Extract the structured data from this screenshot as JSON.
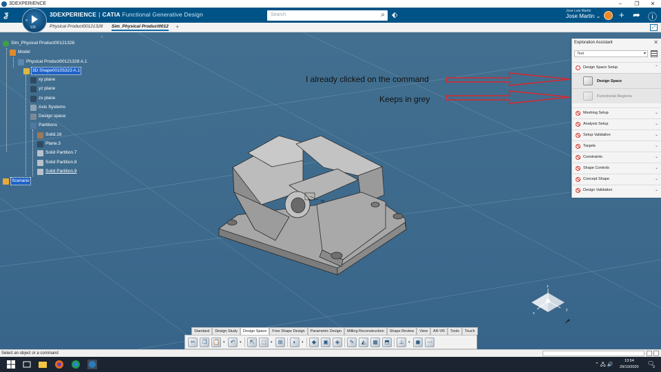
{
  "window": {
    "title": "3DEXPERIENCE",
    "controls": [
      "–",
      "❐",
      "✕"
    ]
  },
  "header": {
    "brand_bold": "3DEXPERIENCE",
    "brand_sep": "|",
    "brand_app": "CATIA",
    "brand_module": "Functional Generative Design",
    "compass_version": "V,R",
    "search_placeholder": "Search",
    "user_small": "Jose Luis Martin",
    "user_name": "Jose Martin",
    "user_caret": "⌄"
  },
  "tabs": [
    {
      "label": "Physical Product00121328",
      "active": false
    },
    {
      "label": "Sim_Physical Product0012",
      "active": true
    }
  ],
  "tab_add": "+",
  "tree": {
    "collapse_marker": "‹",
    "nodes": [
      {
        "label": "Sim_Physical Product00121328"
      },
      {
        "label": "Model"
      },
      {
        "label": "Physical Product00121328 A.1"
      },
      {
        "label": "3D Shape00105323 A.1"
      },
      {
        "label": "xy plane"
      },
      {
        "label": "yz plane"
      },
      {
        "label": "zx plane"
      },
      {
        "label": "Axis Systems"
      },
      {
        "label": "Design space"
      },
      {
        "label": "Partitions"
      },
      {
        "label": "Solid.16"
      },
      {
        "label": "Plane.3"
      },
      {
        "label": "Solid Partition.7"
      },
      {
        "label": "Solid Partition.8"
      },
      {
        "label": "Solid Partition.9"
      },
      {
        "label": "Scenario"
      }
    ]
  },
  "annotations": {
    "clicked": "I already clicked on the command",
    "grey": "Keeps in grey",
    "arrow_color": "#d9262c"
  },
  "exploration": {
    "title": "Exploration Assistant",
    "close": "✕",
    "selected": "Test",
    "rows": [
      {
        "label": "Design Space Setup",
        "chev": "⌃",
        "status": "open"
      },
      {
        "label": "Meshing Setup",
        "chev": "⌄",
        "status": "blocked"
      },
      {
        "label": "Analysis Setup",
        "chev": "⌄",
        "status": "blocked"
      },
      {
        "label": "Setup Validation",
        "chev": "⌄",
        "status": "blocked"
      },
      {
        "label": "Targets",
        "chev": "⌄",
        "status": "blocked"
      },
      {
        "label": "Constraints",
        "chev": "⌄",
        "status": "blocked"
      },
      {
        "label": "Shape Controls",
        "chev": "⌄",
        "status": "blocked"
      },
      {
        "label": "Concept Shape",
        "chev": "⌄",
        "status": "blocked"
      },
      {
        "label": "Design Validation",
        "chev": "⌄",
        "status": "blocked"
      }
    ],
    "sub_items": [
      {
        "label": "Design Space",
        "disabled": false
      },
      {
        "label": "Functional Regions",
        "disabled": true
      }
    ]
  },
  "toolbar": {
    "tabs": [
      "Standard",
      "Design Study",
      "Design Space",
      "Free Shape Design",
      "Parametric Design",
      "Milling Reconstruction",
      "Shape Review",
      "View",
      "AR-VR",
      "Tools",
      "Touch"
    ],
    "active_tab": "Design Space"
  },
  "compass3d": {
    "x": "x",
    "y": "y",
    "z": "z"
  },
  "part": {
    "label": "xy"
  },
  "status": {
    "text": "Select an object or a command"
  },
  "taskbar": {
    "time": "13:54",
    "date": "29/10/2020",
    "notif_count": "3"
  }
}
